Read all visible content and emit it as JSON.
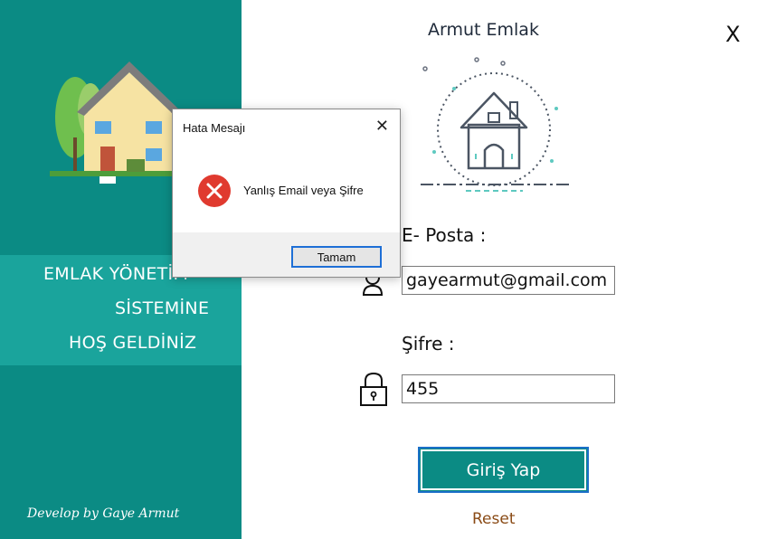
{
  "sidebar": {
    "welcome_lines": [
      "EMLAK YÖNETİM",
      "SİSTEMİNE",
      "HOŞ GELDİNİZ"
    ],
    "credit": "Develop by Gaye Armut"
  },
  "header": {
    "title": "Armut Emlak",
    "close_label": "X"
  },
  "form": {
    "email_label": "E- Posta :",
    "email_value": "gayearmut@gmail.com",
    "password_label": "Şifre :",
    "password_value": "455",
    "login_button": "Giriş Yap",
    "reset_link": "Reset"
  },
  "dialog": {
    "title": "Hata Mesajı",
    "close_label": "✕",
    "message": "Yanlış Email veya Şifre",
    "ok_button": "Tamam",
    "icon": "error-icon"
  },
  "colors": {
    "sidebar": "#0b8b84",
    "sidebar_band": "#1aa49c",
    "button_border": "#1b6fc8",
    "reset": "#8a4b16",
    "error": "#e03a2f"
  }
}
